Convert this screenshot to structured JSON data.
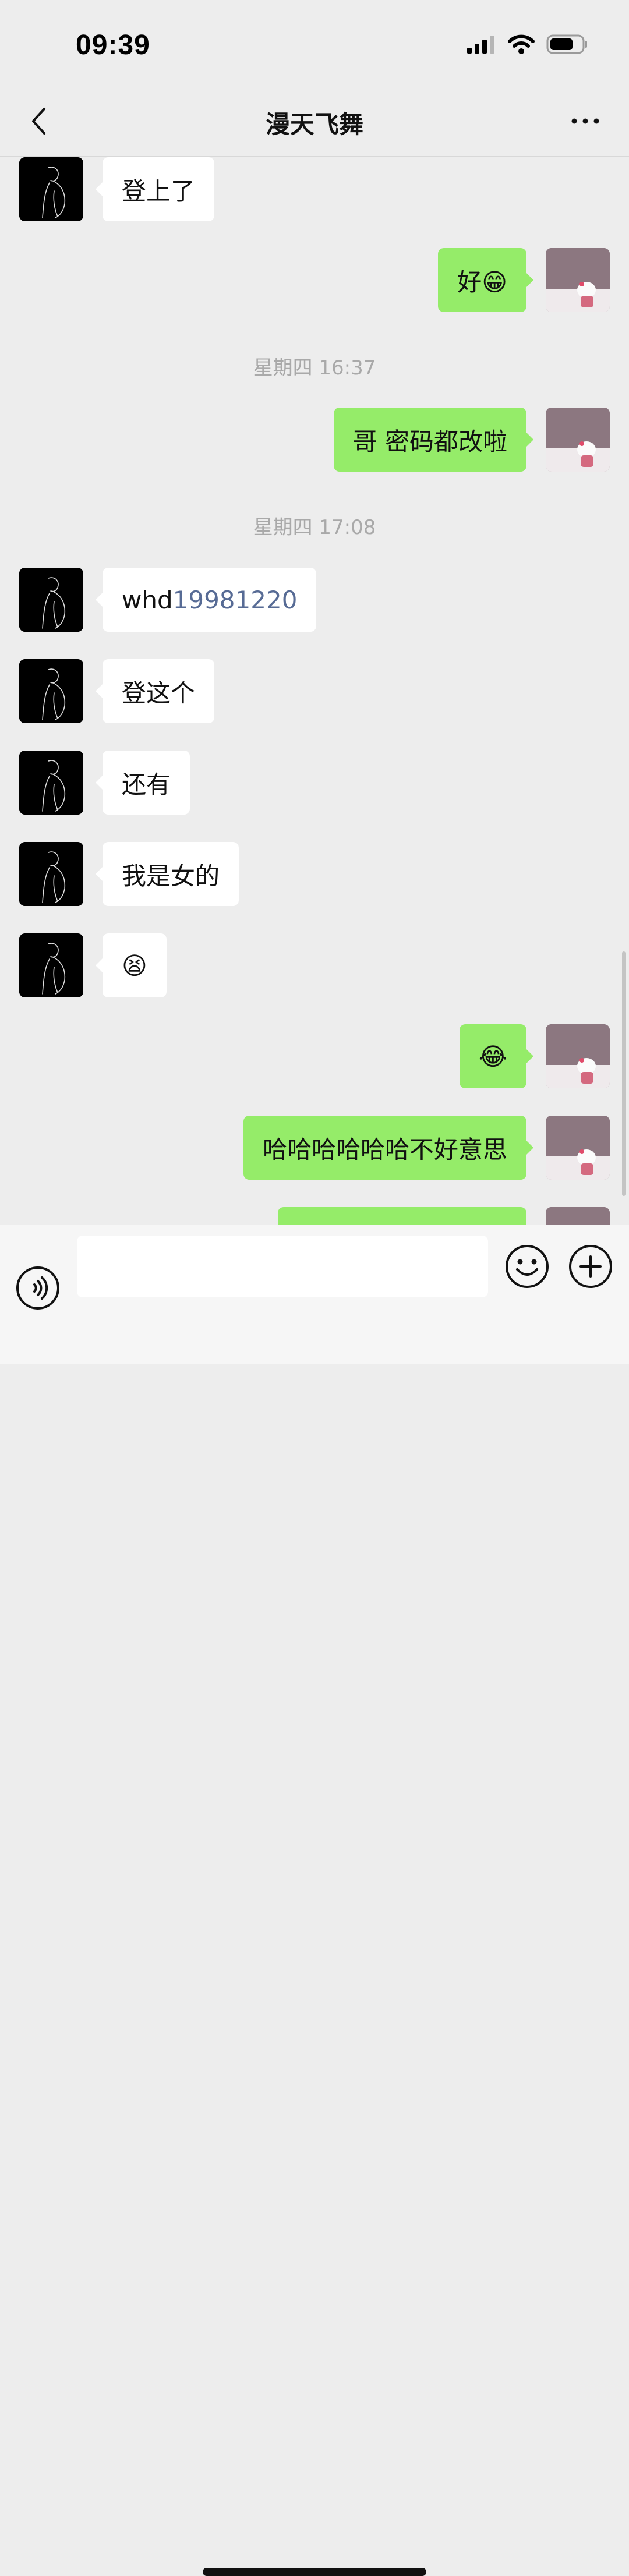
{
  "status": {
    "time": "09:39"
  },
  "header": {
    "title": "漫天飞舞",
    "back_icon": "chevron-left-icon",
    "more_icon": "more-dots-icon"
  },
  "timestamps": {
    "t1": "星期四 16:37",
    "t2": "星期四 17:08"
  },
  "messages": {
    "m1": {
      "from": "contact",
      "text": "登上了"
    },
    "m2": {
      "from": "me",
      "text": "好😁"
    },
    "m3": {
      "from": "me",
      "text": "哥 密码都改啦"
    },
    "m4": {
      "from": "contact",
      "text_prefix": "whd",
      "text_number": "19981220"
    },
    "m5": {
      "from": "contact",
      "text": "登这个"
    },
    "m6": {
      "from": "contact",
      "text": "还有"
    },
    "m7": {
      "from": "contact",
      "text": "我是女的"
    },
    "m8": {
      "from": "contact",
      "text": "😫"
    },
    "m9": {
      "from": "me",
      "text": "😂"
    },
    "m10": {
      "from": "me",
      "text": "哈哈哈哈哈哈不好意思"
    }
  },
  "input_bar": {
    "voice_icon": "voice-icon",
    "emoji_icon": "emoji-icon",
    "plus_icon": "plus-icon",
    "input_value": ""
  },
  "colors": {
    "background": "#ededed",
    "incoming_bubble": "#ffffff",
    "outgoing_bubble": "#95ec69",
    "link": "#576b95",
    "timestamp": "#a9a9a9"
  }
}
